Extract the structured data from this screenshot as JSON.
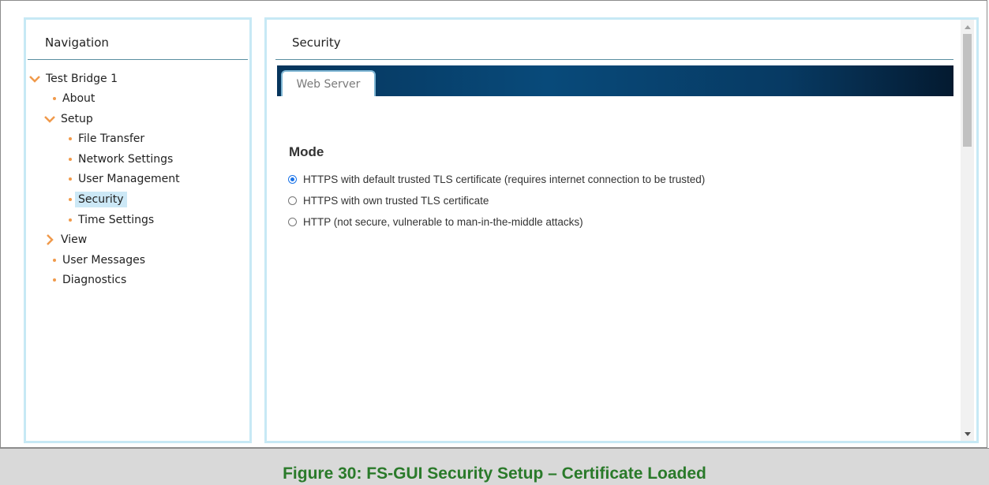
{
  "navigation": {
    "title": "Navigation",
    "items": [
      {
        "label": "Test Bridge 1",
        "kind": "expanded"
      },
      {
        "label": "About",
        "kind": "leaf"
      },
      {
        "label": "Setup",
        "kind": "expanded"
      },
      {
        "label": "File Transfer",
        "kind": "leaf"
      },
      {
        "label": "Network Settings",
        "kind": "leaf"
      },
      {
        "label": "User Management",
        "kind": "leaf"
      },
      {
        "label": "Security",
        "kind": "leaf",
        "selected": true
      },
      {
        "label": "Time Settings",
        "kind": "leaf"
      },
      {
        "label": "View",
        "kind": "collapsed"
      },
      {
        "label": "User Messages",
        "kind": "leaf"
      },
      {
        "label": "Diagnostics",
        "kind": "leaf"
      }
    ]
  },
  "content": {
    "title": "Security",
    "tabs": [
      {
        "label": "Web Server",
        "active": true
      }
    ],
    "mode_heading": "Mode",
    "options": [
      {
        "label": "HTTPS with default trusted TLS certificate (requires internet connection to be trusted)",
        "checked": true
      },
      {
        "label": "HTTPS with own trusted TLS certificate",
        "checked": false
      },
      {
        "label": "HTTP (not secure, vulnerable to man-in-the-middle attacks)",
        "checked": false
      }
    ]
  },
  "caption": "Figure 30: FS-GUI Security Setup – Certificate Loaded",
  "colors": {
    "accent_orange": "#f09a4b",
    "panel_border": "#c7e9f5",
    "tab_bar": "#06355c",
    "selection": "#cce8f6",
    "caption_green": "#2a7a2a"
  }
}
